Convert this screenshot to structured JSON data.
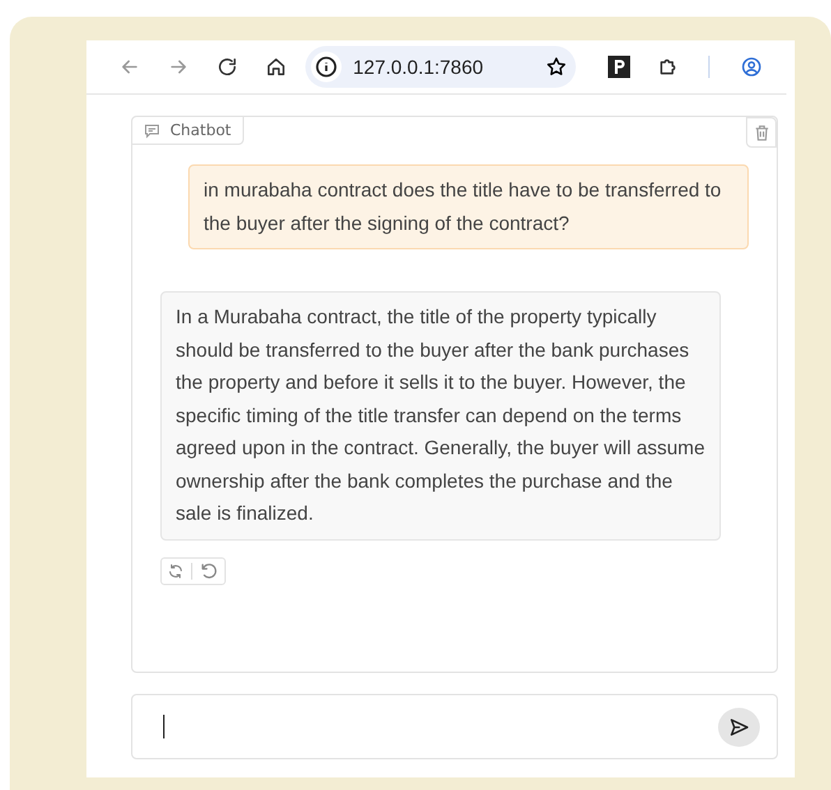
{
  "browser": {
    "url": "127.0.0.1:7860"
  },
  "chatbot": {
    "label": "Chatbot",
    "messages": [
      {
        "kind": "user",
        "text": "in murabaha contract does the title have to be transferred to the buyer after the signing of the contract?"
      },
      {
        "kind": "bot",
        "text": "In a Murabaha contract, the title of the property typically should be transferred to the buyer after the bank purchases the property and before it sells it to the buyer. However, the specific timing of the title transfer can depend on the terms agreed upon in the contract. Generally, the buyer will assume ownership after the bank completes the purchase and the sale is finalized."
      }
    ]
  }
}
